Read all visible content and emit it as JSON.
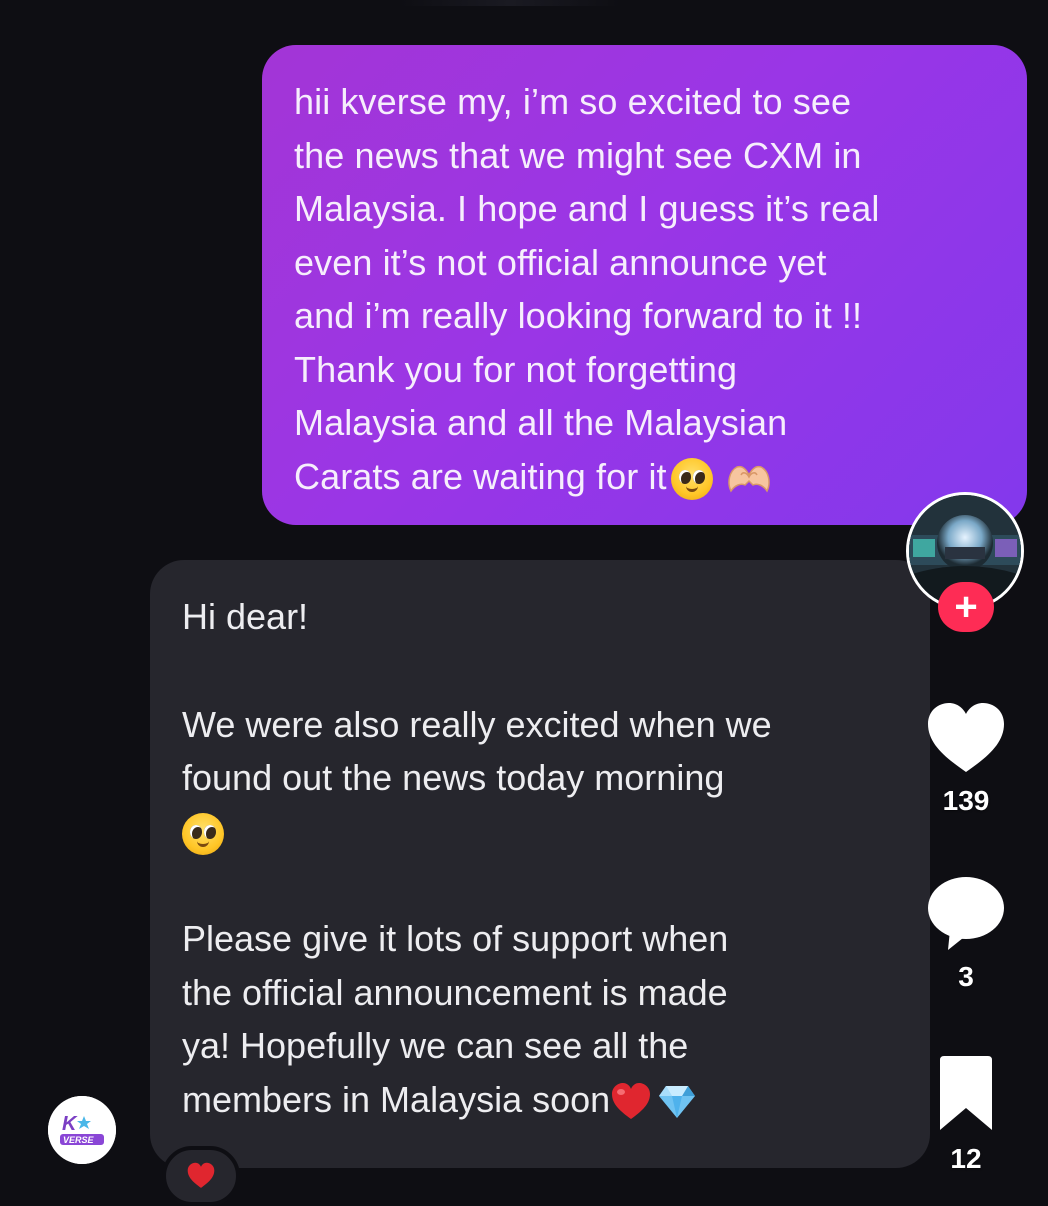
{
  "conversation": {
    "sent_message": {
      "text": "hii kverse my, i’m so excited to see\nthe news that we might see CXM in\nMalaysia. I hope and I guess it’s real\neven it’s not official announce yet\nand i’m really looking forward to it !!\nThank you for not forgetting\nMalaysia and all the Malaysian\nCarats are waiting for it",
      "emojis": [
        "pleading-face",
        "heart-hands"
      ]
    },
    "received_message": {
      "greeting": "Hi dear!",
      "paragraph_1": "We were also really excited when we\nfound out the news today morning",
      "paragraph_1_emoji": "pleading-face",
      "paragraph_2": "Please give it lots of support when\nthe official announcement is made\nya! Hopefully we can see all the\nmembers in Malaysia soon",
      "paragraph_2_emojis": [
        "red-heart",
        "gem"
      ],
      "reaction": "red-heart"
    },
    "sender_avatar_logo_text": "K VERSE"
  },
  "side_rail": {
    "follow_label": "+",
    "likes_count": "139",
    "comments_count": "3",
    "saves_count": "12"
  },
  "colors": {
    "sent_bubble": "#9a36e6",
    "received_bubble": "#26262d",
    "background": "#0e0e13",
    "follow_button": "#fe2c55"
  }
}
